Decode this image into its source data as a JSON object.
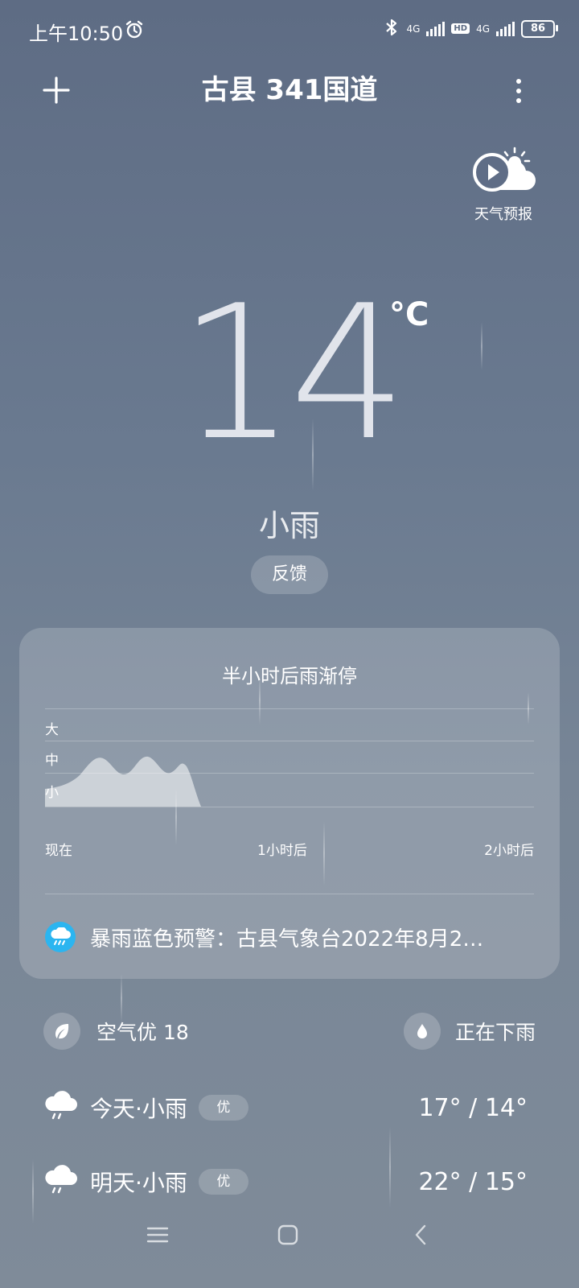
{
  "status": {
    "time": "上午10:50",
    "net1": "4G",
    "hd": "HD",
    "net2": "4G",
    "battery": "86"
  },
  "header": {
    "location": "古县 341国道"
  },
  "forecast_video": {
    "label": "天气预报"
  },
  "current": {
    "temp": "14",
    "unit": "°C",
    "condition": "小雨",
    "feedback_label": "反馈"
  },
  "precip_card": {
    "title": "半小时后雨渐停",
    "levels": [
      "大",
      "中",
      "小"
    ],
    "time_labels": [
      "现在",
      "1小时后",
      "2小时后"
    ],
    "alert": "暴雨蓝色预警：古县气象台2022年8月2…"
  },
  "air": {
    "label": "空气优 18"
  },
  "rain_status": {
    "label": "正在下雨"
  },
  "daily": [
    {
      "label": "今天·小雨",
      "aqi": "优",
      "range": "17° / 14°"
    },
    {
      "label": "明天·小雨",
      "aqi": "优",
      "range": "22° / 15°"
    }
  ],
  "colors": {
    "alert_icon": "#2bb5f0",
    "bg_top": "#5e6c84",
    "bg_bottom": "#7f8b99"
  }
}
